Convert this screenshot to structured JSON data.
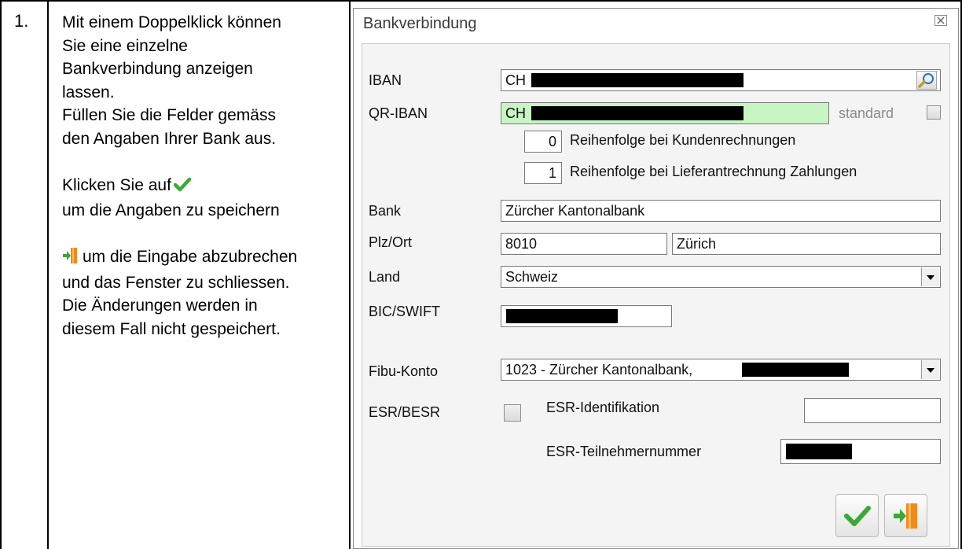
{
  "step": {
    "number": "1.",
    "lines_a": [
      "Mit einem Doppelklick können",
      "Sie eine einzelne",
      "Bankverbindung anzeigen",
      "lassen.",
      "Füllen Sie die Felder gemäss",
      "den Angaben Ihrer Bank aus."
    ],
    "click_text": "Klicken Sie auf",
    "save_text": "um die Angaben zu speichern",
    "exit_text": "um die Eingabe abzubrechen",
    "lines_b": [
      "und das Fenster zu schliessen.",
      "Die Änderungen werden in",
      "diesem Fall nicht gespeichert."
    ]
  },
  "dialog": {
    "title": "Bankverbindung",
    "close_icon": "close-icon",
    "iban": {
      "label": "IBAN",
      "value": "CH"
    },
    "qr_iban": {
      "label": "QR-IBAN",
      "value": "CH",
      "standard_label": "standard"
    },
    "order_customer": {
      "value": "0",
      "label": "Reihenfolge bei Kundenrechnungen"
    },
    "order_supplier": {
      "value": "1",
      "label": "Reihenfolge bei Lieferantrechnung Zahlungen"
    },
    "bank": {
      "label": "Bank",
      "value": "Zürcher Kantonalbank"
    },
    "plz_ort": {
      "label": "Plz/Ort",
      "plz": "8010",
      "ort": "Zürich"
    },
    "land": {
      "label": "Land",
      "value": "Schweiz"
    },
    "bic": {
      "label": "BIC/SWIFT"
    },
    "fibu": {
      "label": "Fibu-Konto",
      "value": "1023 - Zürcher Kantonalbank,"
    },
    "esr": {
      "label": "ESR/BESR",
      "identifikation_label": "ESR-Identifikation",
      "teilnehmer_label": "ESR-Teilnehmernummer"
    },
    "colors": {
      "qr_field_bg": "#c8f5c4",
      "check_green": "#3aa935",
      "exit_orange": "#f08a1c"
    }
  }
}
